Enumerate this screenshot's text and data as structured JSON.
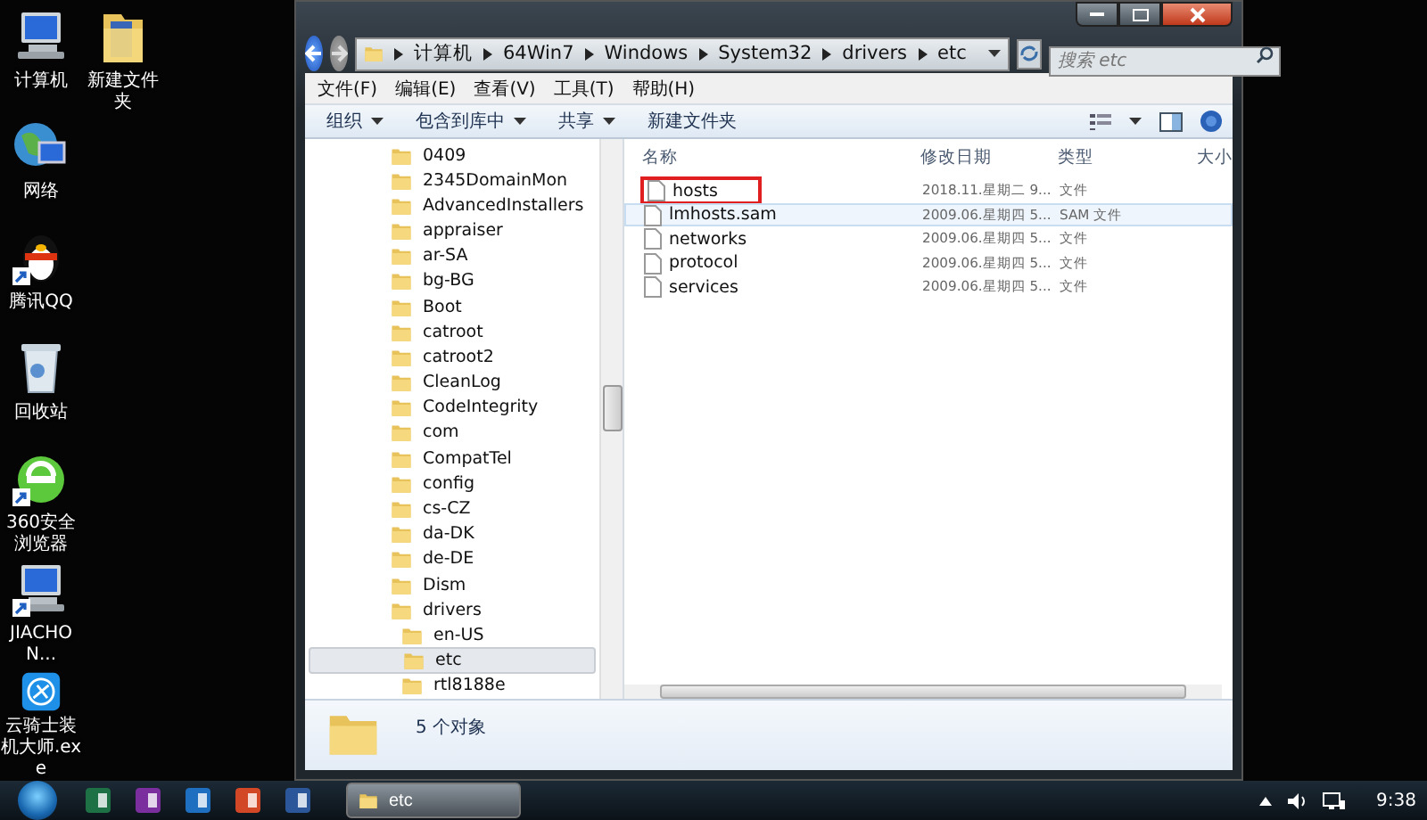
{
  "desktop_columns": [
    [
      {
        "label": "计算机",
        "kind": "computer",
        "shortcut": false
      },
      {
        "label": "网络",
        "kind": "network",
        "shortcut": false
      },
      {
        "label": "腾讯QQ",
        "kind": "penguin",
        "shortcut": true
      },
      {
        "label": "回收站",
        "kind": "bin",
        "shortcut": false
      },
      {
        "label": "360安全浏览器",
        "kind": "browser",
        "shortcut": true
      },
      {
        "label": "JIACHON...",
        "kind": "computer",
        "shortcut": true
      },
      {
        "label": "云骑士装机大师.exe",
        "kind": "app",
        "shortcut": false
      }
    ],
    [
      {
        "label": "新建文件夹",
        "kind": "folder",
        "shortcut": false
      }
    ]
  ],
  "window": {
    "breadcrumb": [
      "计算机",
      "64Win7",
      "Windows",
      "System32",
      "drivers",
      "etc"
    ],
    "search": {
      "placeholder": "搜索 etc"
    },
    "menu": [
      "文件(F)",
      "编辑(E)",
      "查看(V)",
      "工具(T)",
      "帮助(H)"
    ],
    "toolbar": [
      {
        "label": "组织",
        "dropdown": true
      },
      {
        "label": "包含到库中",
        "dropdown": true
      },
      {
        "label": "共享",
        "dropdown": true
      },
      {
        "label": "新建文件夹",
        "dropdown": false
      }
    ],
    "tree": [
      {
        "label": "0409",
        "selected": false
      },
      {
        "label": "2345DomainMon",
        "selected": false
      },
      {
        "label": "AdvancedInstallers",
        "selected": false
      },
      {
        "label": "appraiser",
        "selected": false
      },
      {
        "label": "ar-SA",
        "selected": false
      },
      {
        "label": "bg-BG",
        "selected": false
      },
      {
        "label": "Boot",
        "selected": false
      },
      {
        "label": "catroot",
        "selected": false
      },
      {
        "label": "catroot2",
        "selected": false
      },
      {
        "label": "CleanLog",
        "selected": false
      },
      {
        "label": "CodeIntegrity",
        "selected": false
      },
      {
        "label": "com",
        "selected": false
      },
      {
        "label": "CompatTel",
        "selected": false
      },
      {
        "label": "config",
        "selected": false
      },
      {
        "label": "cs-CZ",
        "selected": false
      },
      {
        "label": "da-DK",
        "selected": false
      },
      {
        "label": "de-DE",
        "selected": false
      },
      {
        "label": "Dism",
        "selected": false
      },
      {
        "label": "drivers",
        "selected": false,
        "children": [
          {
            "label": "en-US",
            "selected": false
          },
          {
            "label": "etc",
            "selected": true
          },
          {
            "label": "rtl8188e",
            "selected": false
          }
        ]
      }
    ],
    "columns": [
      "名称",
      "修改日期",
      "类型",
      "大小"
    ],
    "files": [
      {
        "name": "hosts",
        "modified": "2018.11.星期二 9...",
        "type": "文件",
        "hovered": false,
        "outlined": true
      },
      {
        "name": "lmhosts.sam",
        "modified": "2009.06.星期四 5...",
        "type": "SAM 文件",
        "hovered": true,
        "outlined": false
      },
      {
        "name": "networks",
        "modified": "2009.06.星期四 5...",
        "type": "文件",
        "hovered": false,
        "outlined": false
      },
      {
        "name": "protocol",
        "modified": "2009.06.星期四 5...",
        "type": "文件",
        "hovered": false,
        "outlined": false
      },
      {
        "name": "services",
        "modified": "2009.06.星期四 5...",
        "type": "文件",
        "hovered": false,
        "outlined": false
      }
    ],
    "status": "5 个对象"
  },
  "taskbar": {
    "apps": [
      {
        "kind": "excel"
      },
      {
        "kind": "onenote"
      },
      {
        "kind": "outlook"
      },
      {
        "kind": "powerpoint"
      },
      {
        "kind": "word"
      }
    ],
    "window_button": {
      "label": "etc"
    },
    "clock": "9:38"
  }
}
